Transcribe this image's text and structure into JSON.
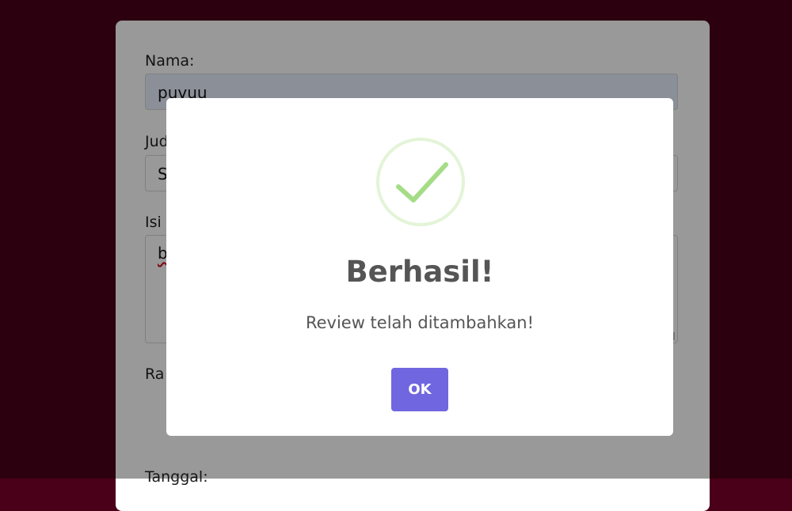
{
  "form": {
    "nama_label": "Nama:",
    "nama_value": "puvuu",
    "judul_label_partial": "Jud",
    "judul_value_partial": "S",
    "isi_label_partial": "Isi",
    "isi_value_partial": "b",
    "rating_label_partial": "Ra",
    "tanggal_label_partial": "Tanggal:"
  },
  "modal": {
    "icon": "success-check-icon",
    "title": "Berhasil!",
    "text": "Review telah ditambahkan!",
    "ok_label": "OK"
  },
  "colors": {
    "page_background": "#4a0018",
    "confirm_button": "#7066e0",
    "success_check": "#a5dc86"
  }
}
